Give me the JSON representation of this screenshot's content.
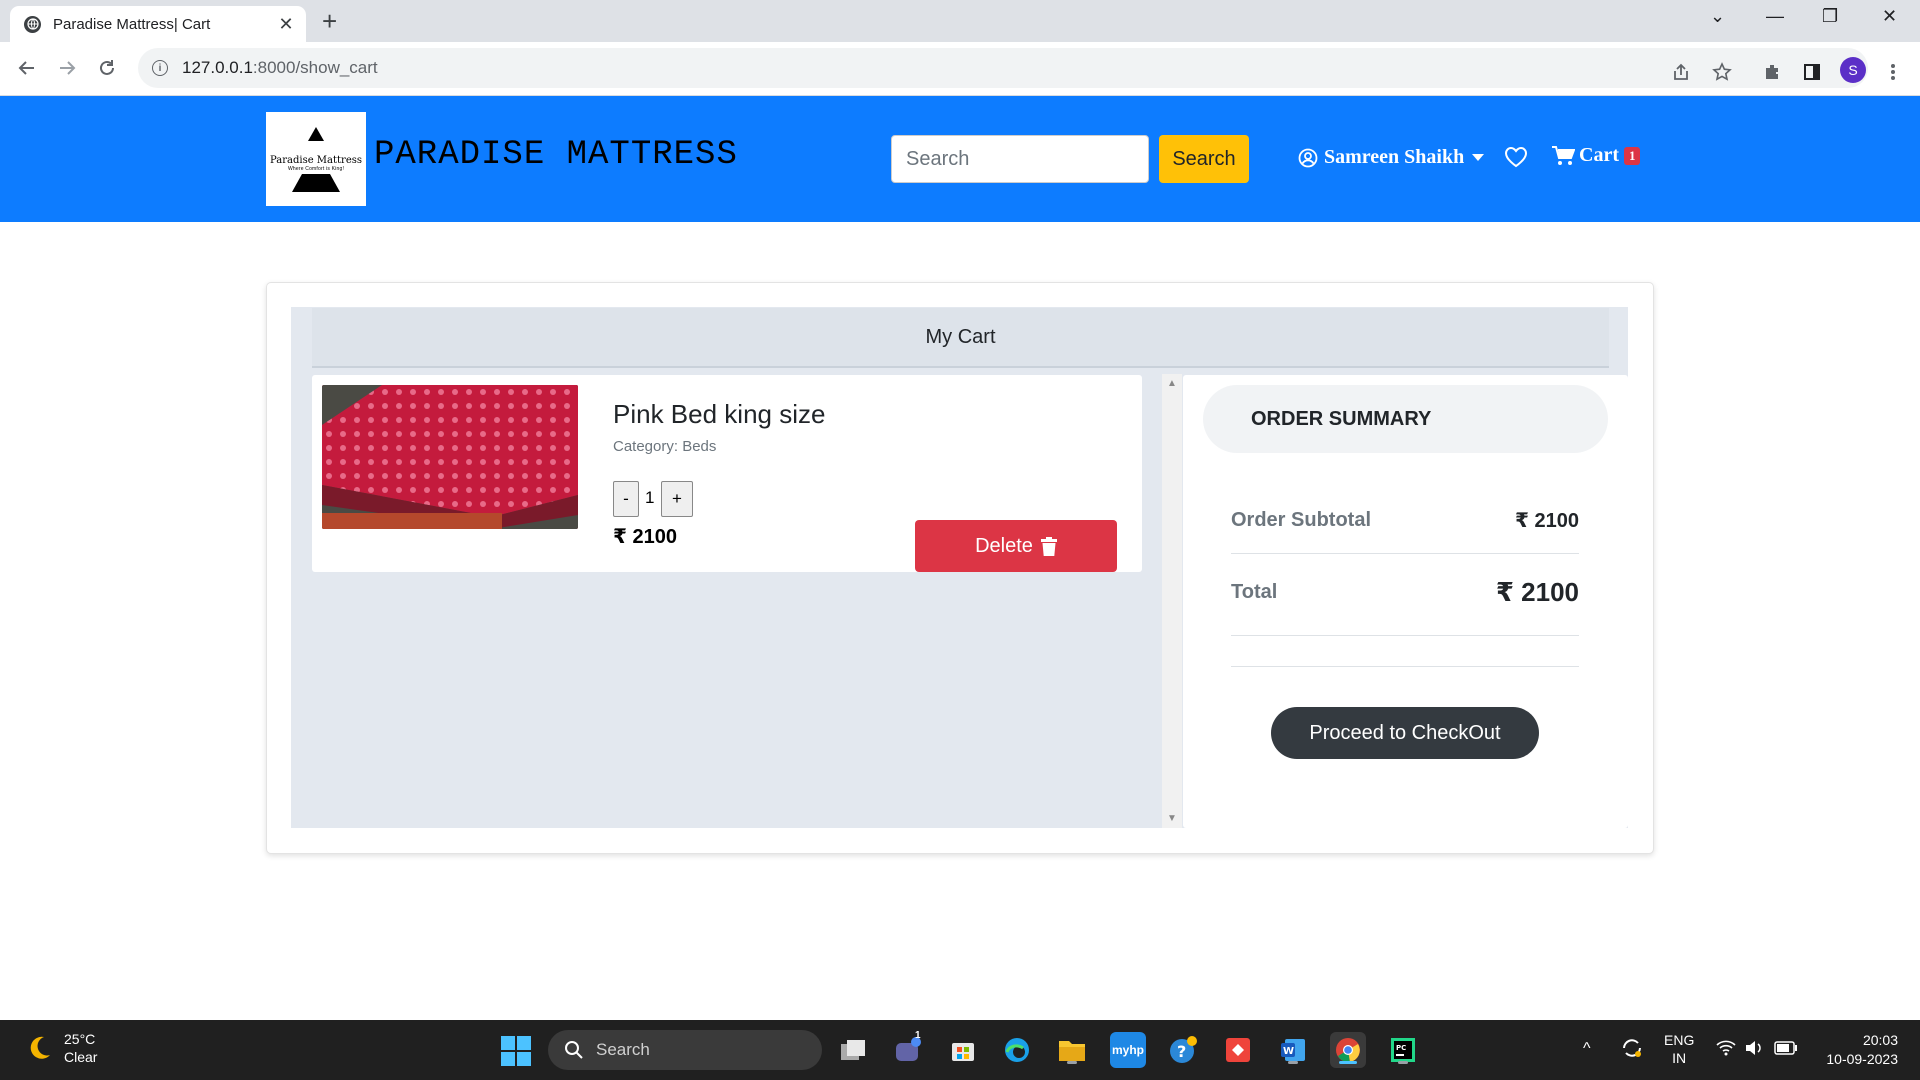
{
  "browser": {
    "tab_title": "Paradise Mattress| Cart",
    "url_host": "127.0.0.1",
    "url_rest": ":8000/show_cart",
    "profile_initial": "S"
  },
  "header": {
    "logo_name": "Paradise Mattress",
    "logo_tagline": "Where Comfort is King!",
    "brand": "PARADISE MATTRESS",
    "search_placeholder": "Search",
    "search_button": "Search",
    "user_name": "Samreen Shaikh",
    "cart_label": "Cart",
    "cart_count": "1",
    "accent_color": "#0d7cff"
  },
  "cart": {
    "title": "My Cart",
    "items": [
      {
        "name": "Pink Bed king size",
        "category": "Category: Beds",
        "qty_minus": "-",
        "quantity": "1",
        "qty_plus": "+",
        "price": "₹ 2100",
        "delete_label": "Delete"
      }
    ]
  },
  "summary": {
    "title": "ORDER SUMMARY",
    "subtotal_label": "Order Subtotal",
    "subtotal_value": "₹ 2100",
    "total_label": "Total",
    "total_value": "₹ 2100",
    "checkout_label": "Proceed to CheckOut"
  },
  "taskbar": {
    "temperature": "25°C",
    "condition": "Clear",
    "search_label": "Search",
    "teams_badge": "1",
    "language_top": "ENG",
    "language_bottom": "IN",
    "time": "20:03",
    "date": "10-09-2023"
  }
}
